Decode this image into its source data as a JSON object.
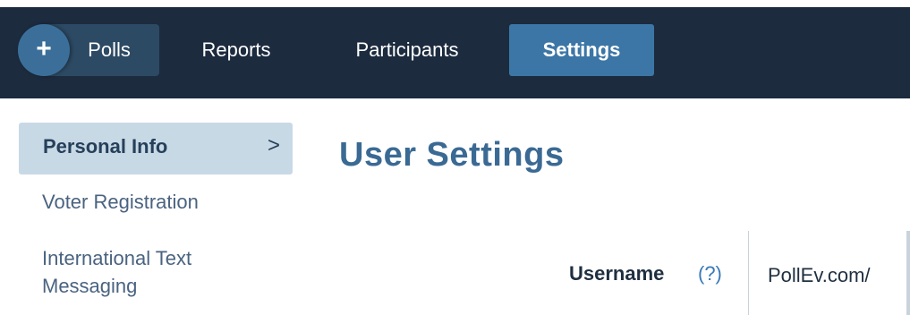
{
  "nav": {
    "add_icon": "+",
    "items": [
      {
        "label": "Polls"
      },
      {
        "label": "Reports"
      },
      {
        "label": "Participants"
      },
      {
        "label": "Settings",
        "active": true
      }
    ]
  },
  "sidebar": {
    "items": [
      {
        "label": "Personal Info",
        "active": true,
        "chevron": ">"
      },
      {
        "label": "Voter Registration"
      },
      {
        "label": "International Text Messaging"
      }
    ]
  },
  "main": {
    "title": "User Settings",
    "username_label": "Username",
    "help_link": "(?)",
    "url_prefix": "PollEv.com/"
  },
  "colors": {
    "navbar_bg": "#1c2b3e",
    "active_tab": "#3c76a6",
    "title_color": "#3a6a94",
    "sidebar_active_bg": "#c8d9e6"
  }
}
